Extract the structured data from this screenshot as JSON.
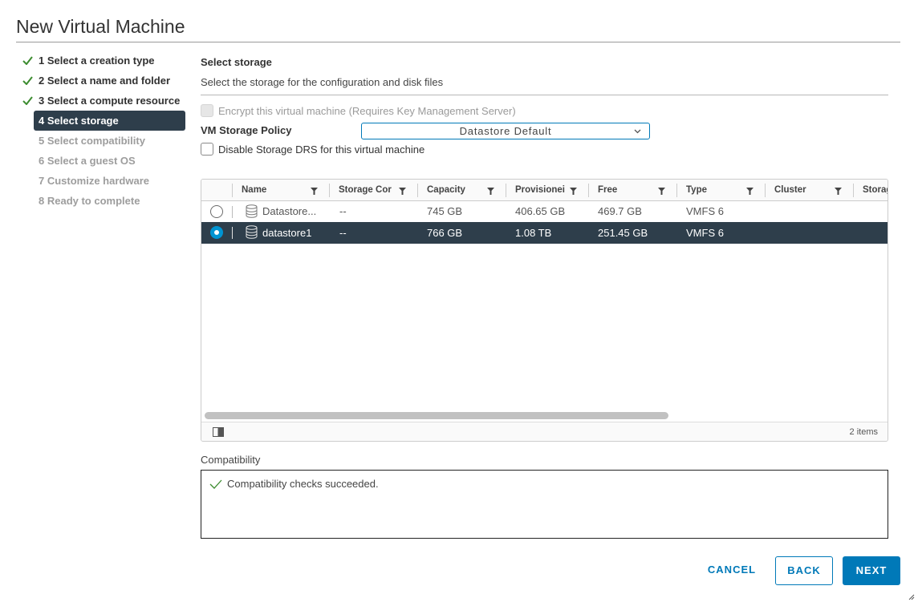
{
  "window": {
    "title": "New Virtual Machine"
  },
  "steps": [
    {
      "label": "1 Select a creation type",
      "state": "done"
    },
    {
      "label": "2 Select a name and folder",
      "state": "done"
    },
    {
      "label": "3 Select a compute resource",
      "state": "done"
    },
    {
      "label": "4 Select storage",
      "state": "active"
    },
    {
      "label": "5 Select compatibility",
      "state": "pending"
    },
    {
      "label": "6 Select a guest OS",
      "state": "pending"
    },
    {
      "label": "7 Customize hardware",
      "state": "pending"
    },
    {
      "label": "8 Ready to complete",
      "state": "pending"
    }
  ],
  "page": {
    "title": "Select storage",
    "subtitle": "Select the storage for the configuration and disk files"
  },
  "encrypt": {
    "label": "Encrypt this virtual machine (Requires Key Management Server)",
    "checked": false,
    "disabled": true
  },
  "policy": {
    "label": "VM Storage Policy",
    "value": "Datastore Default"
  },
  "drs": {
    "label": "Disable Storage DRS for this virtual machine",
    "checked": false
  },
  "grid": {
    "columns": [
      "Name",
      "Storage Cor",
      "Capacity",
      "Provisionei",
      "Free",
      "Type",
      "Cluster",
      "Storag"
    ],
    "rows": [
      {
        "selected": false,
        "name": "Datastore...",
        "storage_compat": "--",
        "capacity": "745 GB",
        "provisioned": "406.65 GB",
        "free": "469.7 GB",
        "type": "VMFS 6",
        "cluster": "",
        "storage": ""
      },
      {
        "selected": true,
        "name": "datastore1",
        "storage_compat": "--",
        "capacity": "766 GB",
        "provisioned": "1.08 TB",
        "free": "251.45 GB",
        "type": "VMFS 6",
        "cluster": "",
        "storage": ""
      }
    ],
    "footer_count": "2 items"
  },
  "compatibility": {
    "label": "Compatibility",
    "message": "Compatibility checks succeeded."
  },
  "buttons": {
    "cancel": "CANCEL",
    "back": "BACK",
    "next": "NEXT"
  },
  "colors": {
    "accent": "#0079b8",
    "selected_row": "#2e3e4b",
    "success": "#3c8c2f"
  }
}
